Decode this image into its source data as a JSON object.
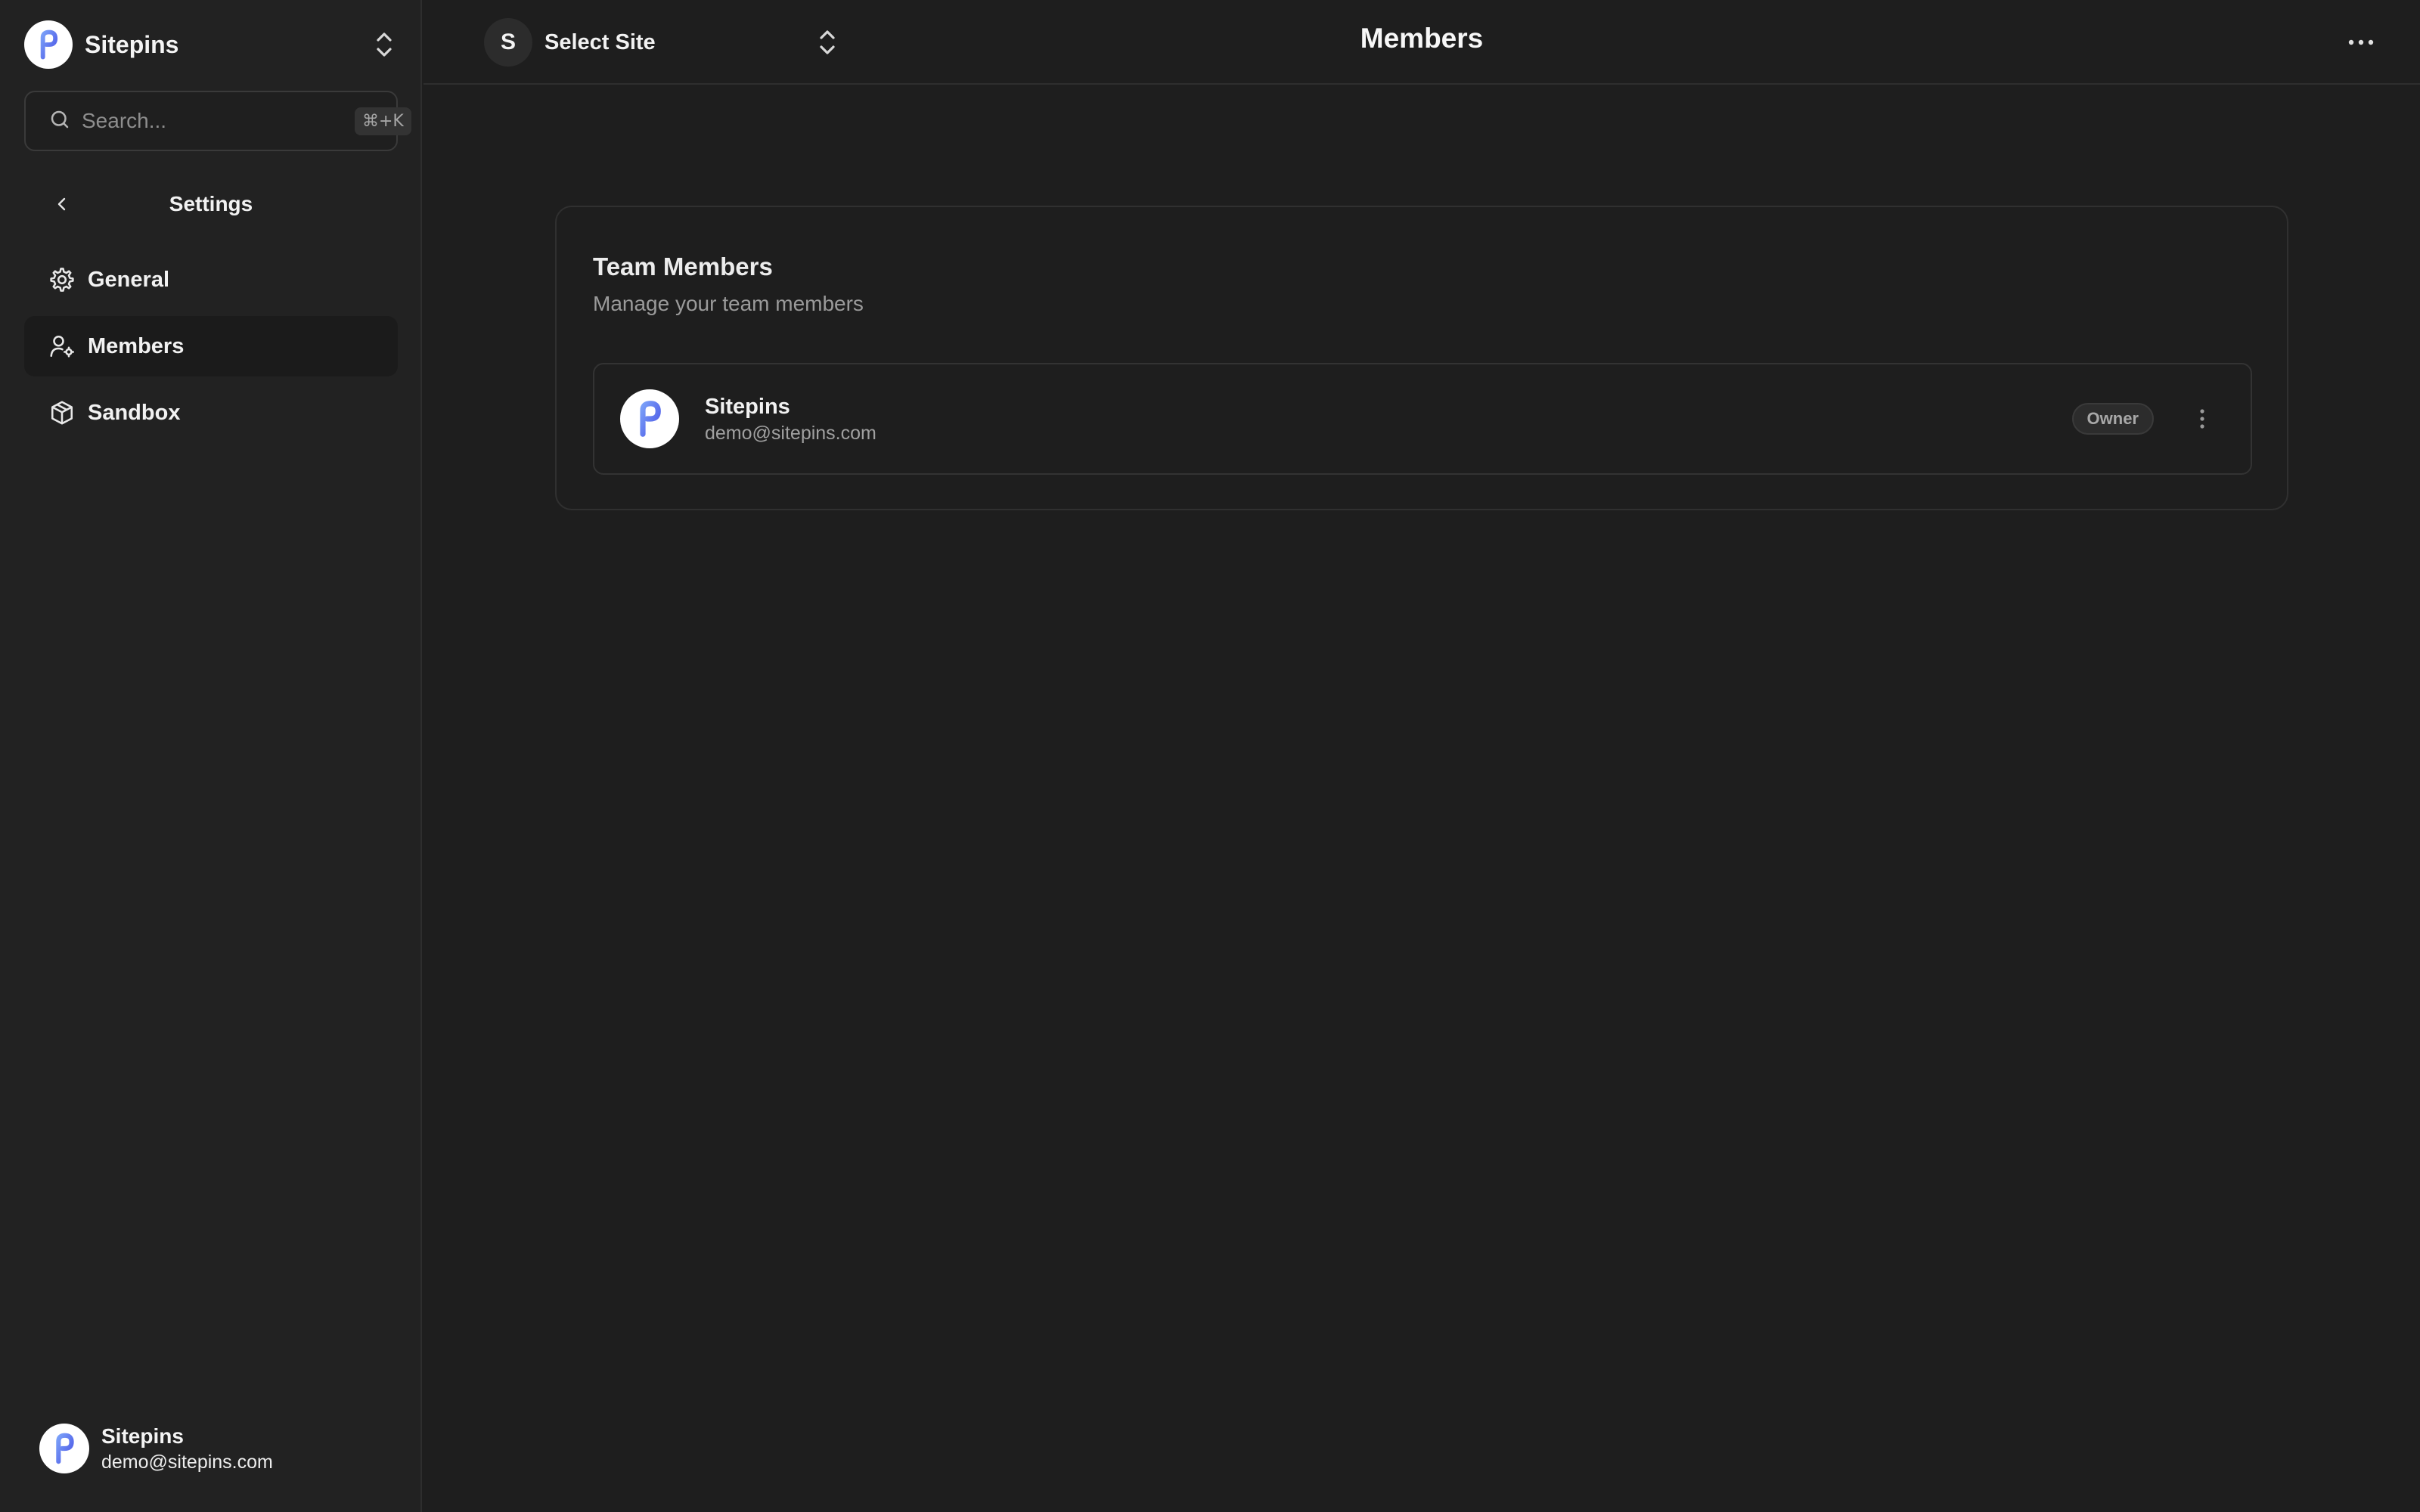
{
  "workspace": {
    "name": "Sitepins"
  },
  "search": {
    "placeholder": "Search...",
    "shortcut": "⌘+K"
  },
  "settings": {
    "title": "Settings"
  },
  "nav": {
    "items": [
      {
        "label": "General",
        "icon": "gear-icon",
        "active": false
      },
      {
        "label": "Members",
        "icon": "user-cog-icon",
        "active": true
      },
      {
        "label": "Sandbox",
        "icon": "box-icon",
        "active": false
      }
    ]
  },
  "user": {
    "name": "Sitepins",
    "email": "demo@sitepins.com"
  },
  "topbar": {
    "site_initial": "S",
    "site_label": "Select Site",
    "page_title": "Members"
  },
  "card": {
    "title": "Team Members",
    "subtitle": "Manage your team members",
    "members": [
      {
        "name": "Sitepins",
        "email": "demo@sitepins.com",
        "role": "Owner"
      }
    ]
  },
  "colors": {
    "background": "#1e1e1e",
    "sidebar": "#222222",
    "border": "#303030",
    "logo_gradient_start": "#6d8cf5",
    "logo_gradient_end": "#4f5fe8"
  }
}
